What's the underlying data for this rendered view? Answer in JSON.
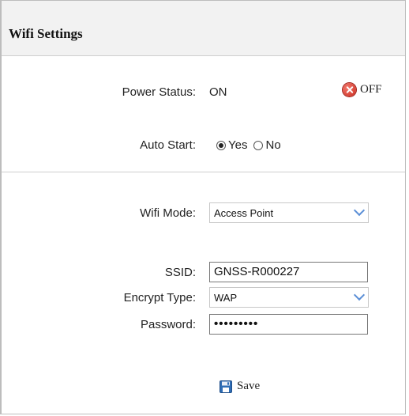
{
  "header": {
    "title": "Wifi Settings"
  },
  "power": {
    "label": "Power Status:",
    "value": "ON",
    "off_button": "OFF"
  },
  "auto_start": {
    "label": "Auto Start:",
    "options": [
      "Yes",
      "No"
    ],
    "selected": "Yes"
  },
  "wifi_mode": {
    "label": "Wifi Mode:",
    "value": "Access Point"
  },
  "ssid": {
    "label": "SSID:",
    "value": "GNSS-R000227"
  },
  "encrypt": {
    "label": "Encrypt Type:",
    "value": "WAP"
  },
  "password": {
    "label": "Password:",
    "value": "•••••••••"
  },
  "save": {
    "label": "Save"
  },
  "colors": {
    "off_icon": "#d9362b",
    "save_icon": "#2f6db5",
    "header_bg": "#f2f2f2",
    "chevron": "#5b8fd6"
  }
}
